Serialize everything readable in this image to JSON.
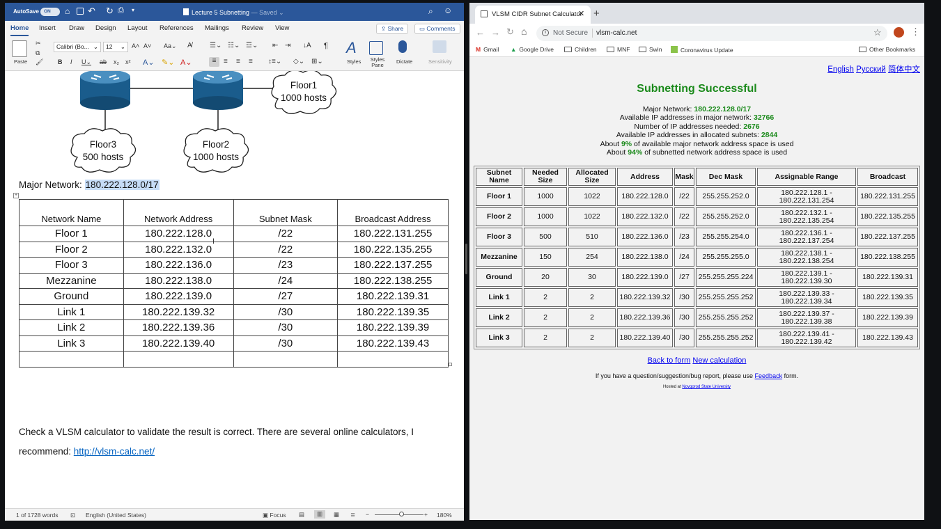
{
  "word": {
    "autosave_label": "AutoSave",
    "autosave_state": "ON",
    "doc_title": "Lecture 5 Subnetting",
    "doc_saved": "— Saved",
    "tabs": [
      "Home",
      "Insert",
      "Draw",
      "Design",
      "Layout",
      "References",
      "Mailings",
      "Review",
      "View"
    ],
    "share_label": "Share",
    "comments_label": "Comments",
    "paste_label": "Paste",
    "font_name": "Calibri (Bo...",
    "font_size": "12",
    "styles_label": "Styles",
    "styles_pane_label": "Styles Pane",
    "dictate_label": "Dictate",
    "sensitivity_label": "Sensitivity",
    "diagram": {
      "floor1": [
        "Floor1",
        "1000 hosts"
      ],
      "floor2": [
        "Floor2",
        "1000 hosts"
      ],
      "floor3": [
        "Floor3",
        "500 hosts"
      ]
    },
    "major_network_label": "Major Network:",
    "major_network_value": "180.222.128.0/17",
    "table_headers": [
      "Network Name",
      "Network Address",
      "Subnet Mask",
      "Broadcast Address"
    ],
    "table_rows": [
      [
        "Floor 1",
        "180.222.128.0",
        "/22",
        "180.222.131.255"
      ],
      [
        "Floor 2",
        "180.222.132.0",
        "/22",
        "180.222.135.255"
      ],
      [
        "Floor 3",
        "180.222.136.0",
        "/23",
        "180.222.137.255"
      ],
      [
        "Mezzanine",
        "180.222.138.0",
        "/24",
        "180.222.138.255"
      ],
      [
        "Ground",
        "180.222.139.0",
        "/27",
        "180.222.139.31"
      ],
      [
        "Link 1",
        "180.222.139.32",
        "/30",
        "180.222.139.35"
      ],
      [
        "Link 2",
        "180.222.139.36",
        "/30",
        "180.222.139.39"
      ],
      [
        "Link 3",
        "180.222.139.40",
        "/30",
        "180.222.139.43"
      ]
    ],
    "paragraph_line1": "Check a VLSM calculator to validate the result is correct. There are several online calculators, I",
    "paragraph_line2_prefix": "recommend: ",
    "paragraph_link": "http://vlsm-calc.net/",
    "status_words": "1 of 1728 words",
    "status_language": "English (United States)",
    "status_focus": "Focus",
    "status_zoom": "180%"
  },
  "chrome": {
    "tab_title": "VLSM CIDR Subnet Calculator",
    "not_secure": "Not Secure",
    "url": "vlsm-calc.net",
    "bookmarks": [
      "Gmail",
      "Google Drive",
      "Children",
      "MNF",
      "Swin",
      "Coronavirus Update"
    ],
    "other_bookmarks": "Other Bookmarks",
    "languages": [
      "English",
      "Русский",
      "简体中文"
    ],
    "heading": "Subnetting Successful",
    "summary": {
      "major_network_label": "Major Network:",
      "major_network_value": "180.222.128.0/17",
      "available_label": "Available IP addresses in major network:",
      "available_value": "32766",
      "needed_label": "Number of IP addresses needed:",
      "needed_value": "2676",
      "allocated_label": "Available IP addresses in allocated subnets:",
      "allocated_value": "2844",
      "about1_prefix": "About",
      "about1_value": "9%",
      "about1_suffix": "of available major network address space is used",
      "about2_prefix": "About",
      "about2_value": "94%",
      "about2_suffix": "of subnetted network address space is used"
    },
    "table_headers": [
      "Subnet Name",
      "Needed Size",
      "Allocated Size",
      "Address",
      "Mask",
      "Dec Mask",
      "Assignable Range",
      "Broadcast"
    ],
    "table_rows": [
      [
        "Floor 1",
        "1000",
        "1022",
        "180.222.128.0",
        "/22",
        "255.255.252.0",
        "180.222.128.1 - 180.222.131.254",
        "180.222.131.255"
      ],
      [
        "Floor 2",
        "1000",
        "1022",
        "180.222.132.0",
        "/22",
        "255.255.252.0",
        "180.222.132.1 - 180.222.135.254",
        "180.222.135.255"
      ],
      [
        "Floor 3",
        "500",
        "510",
        "180.222.136.0",
        "/23",
        "255.255.254.0",
        "180.222.136.1 - 180.222.137.254",
        "180.222.137.255"
      ],
      [
        "Mezzanine",
        "150",
        "254",
        "180.222.138.0",
        "/24",
        "255.255.255.0",
        "180.222.138.1 - 180.222.138.254",
        "180.222.138.255"
      ],
      [
        "Ground",
        "20",
        "30",
        "180.222.139.0",
        "/27",
        "255.255.255.224",
        "180.222.139.1 - 180.222.139.30",
        "180.222.139.31"
      ],
      [
        "Link 1",
        "2",
        "2",
        "180.222.139.32",
        "/30",
        "255.255.255.252",
        "180.222.139.33 - 180.222.139.34",
        "180.222.139.35"
      ],
      [
        "Link 2",
        "2",
        "2",
        "180.222.139.36",
        "/30",
        "255.255.255.252",
        "180.222.139.37 - 180.222.139.38",
        "180.222.139.39"
      ],
      [
        "Link 3",
        "2",
        "2",
        "180.222.139.40",
        "/30",
        "255.255.255.252",
        "180.222.139.41 - 180.222.139.42",
        "180.222.139.43"
      ]
    ],
    "back_to_form": "Back to form",
    "new_calculation": "New calculation",
    "feedback_prefix": "If you have a question/suggestion/bug report, please use",
    "feedback_link": "Feedback",
    "feedback_suffix": "form.",
    "hosted_prefix": "Hosted at",
    "hosted_link": "Novgorod State University"
  },
  "colors": {
    "word_blue": "#2b579a",
    "success_green": "#1b8a1b",
    "link_blue": "#0000ee",
    "selection": "#c6dcf7"
  }
}
